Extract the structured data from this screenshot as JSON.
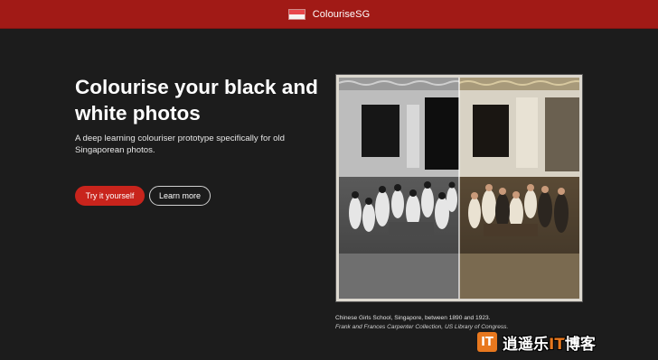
{
  "header": {
    "brand_name": "ColouriseSG",
    "flag_colors": {
      "top": "#e8474b",
      "bottom": "#f7f3f0"
    },
    "background": "#a11a16"
  },
  "hero": {
    "title": "Colourise your black and white photos",
    "description": "A deep learning colouriser prototype specifically for old Singaporean photos.",
    "primary_button": "Try it yourself",
    "secondary_button": "Learn more"
  },
  "photo": {
    "left_style": "black-and-white",
    "right_style": "colourised"
  },
  "caption": {
    "line1": "Chinese Girls School, Singapore, between 1890 and 1923.",
    "line2": "Frank and Frances Carpenter Collection, US Library of Congress."
  },
  "watermark": {
    "logo_letter": "IT",
    "text_prefix": "逍遥乐",
    "text_highlight": "IT",
    "text_suffix": "博客"
  },
  "colors": {
    "accent": "#c8241c",
    "page_background": "#1c1c1c"
  }
}
